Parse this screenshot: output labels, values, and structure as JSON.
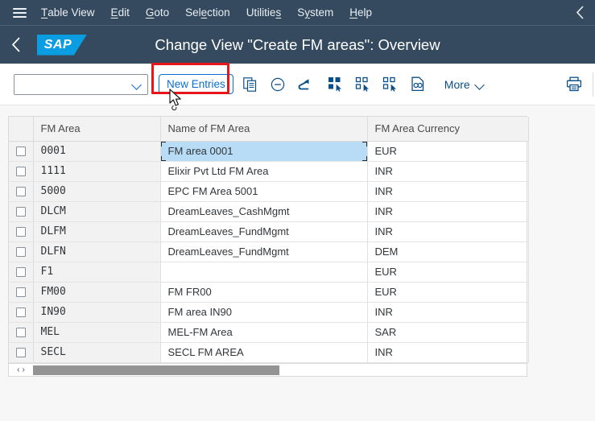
{
  "menubar": {
    "burger_icon": "hamburger-menu-icon",
    "items": [
      {
        "label": "Table View",
        "mnemonic_index": 0
      },
      {
        "label": "Edit",
        "mnemonic_index": 0
      },
      {
        "label": "Goto",
        "mnemonic_index": 0
      },
      {
        "label": "Selection",
        "mnemonic_index": 3
      },
      {
        "label": "Utilities",
        "mnemonic_index": 8
      },
      {
        "label": "System",
        "mnemonic_index": 1
      },
      {
        "label": "Help",
        "mnemonic_index": 0
      }
    ],
    "collapse_icon": "chevron-left-icon"
  },
  "shellbar": {
    "back_icon": "chevron-left-icon",
    "logo_text": "SAP",
    "title": "Change View \"Create FM areas\": Overview"
  },
  "toolbar": {
    "variant_select_value": "",
    "variant_select_placeholder": "",
    "new_entries_label": "New Entries",
    "copy_icon": "copy-as-icon",
    "delete_icon": "minus-circle-icon",
    "undo_icon": "undo-arrow-icon",
    "select_all_icon": "select-all-icon",
    "deselect_all_icon": "deselect-all-icon",
    "select_block_icon": "select-block-icon",
    "variants_icon": "display-variant-icon",
    "more_label": "More",
    "more_chevron_icon": "chevron-down-icon",
    "print_icon": "printer-icon",
    "highlight_color": "#e8161a"
  },
  "table": {
    "columns": [
      "FM Area",
      "Name of FM Area",
      "FM Area Currency"
    ],
    "selected_cell": {
      "row": 0,
      "column": 1
    },
    "rows": [
      {
        "checked": false,
        "fm_area": "0001",
        "name": "FM area 0001",
        "currency": "EUR"
      },
      {
        "checked": false,
        "fm_area": "1111",
        "name": "Elixir Pvt Ltd FM Area",
        "currency": "INR"
      },
      {
        "checked": false,
        "fm_area": "5000",
        "name": "EPC FM Area 5001",
        "currency": "INR"
      },
      {
        "checked": false,
        "fm_area": "DLCM",
        "name": "DreamLeaves_CashMgmt",
        "currency": "INR"
      },
      {
        "checked": false,
        "fm_area": "DLFM",
        "name": "DreamLeaves_FundMgmt",
        "currency": "INR"
      },
      {
        "checked": false,
        "fm_area": "DLFN",
        "name": "DreamLeaves_FundMgmt",
        "currency": "DEM"
      },
      {
        "checked": false,
        "fm_area": "F1",
        "name": "",
        "currency": "EUR"
      },
      {
        "checked": false,
        "fm_area": "FM00",
        "name": "FM FR00",
        "currency": "EUR"
      },
      {
        "checked": false,
        "fm_area": "IN90",
        "name": "FM area IN90",
        "currency": "INR"
      },
      {
        "checked": false,
        "fm_area": "MEL",
        "name": "MEL-FM Area",
        "currency": "SAR"
      },
      {
        "checked": false,
        "fm_area": "SECL",
        "name": "SECL FM AREA",
        "currency": "INR"
      }
    ]
  },
  "scrollbar": {
    "left_arrow": "‹",
    "right_arrow": "›"
  },
  "colors": {
    "shell_bg": "#354a5f",
    "accent": "#0a6ed1",
    "logo_blue": "#0a9de2",
    "selection_blue": "#b8dcf5",
    "highlight_red": "#e8161a"
  }
}
